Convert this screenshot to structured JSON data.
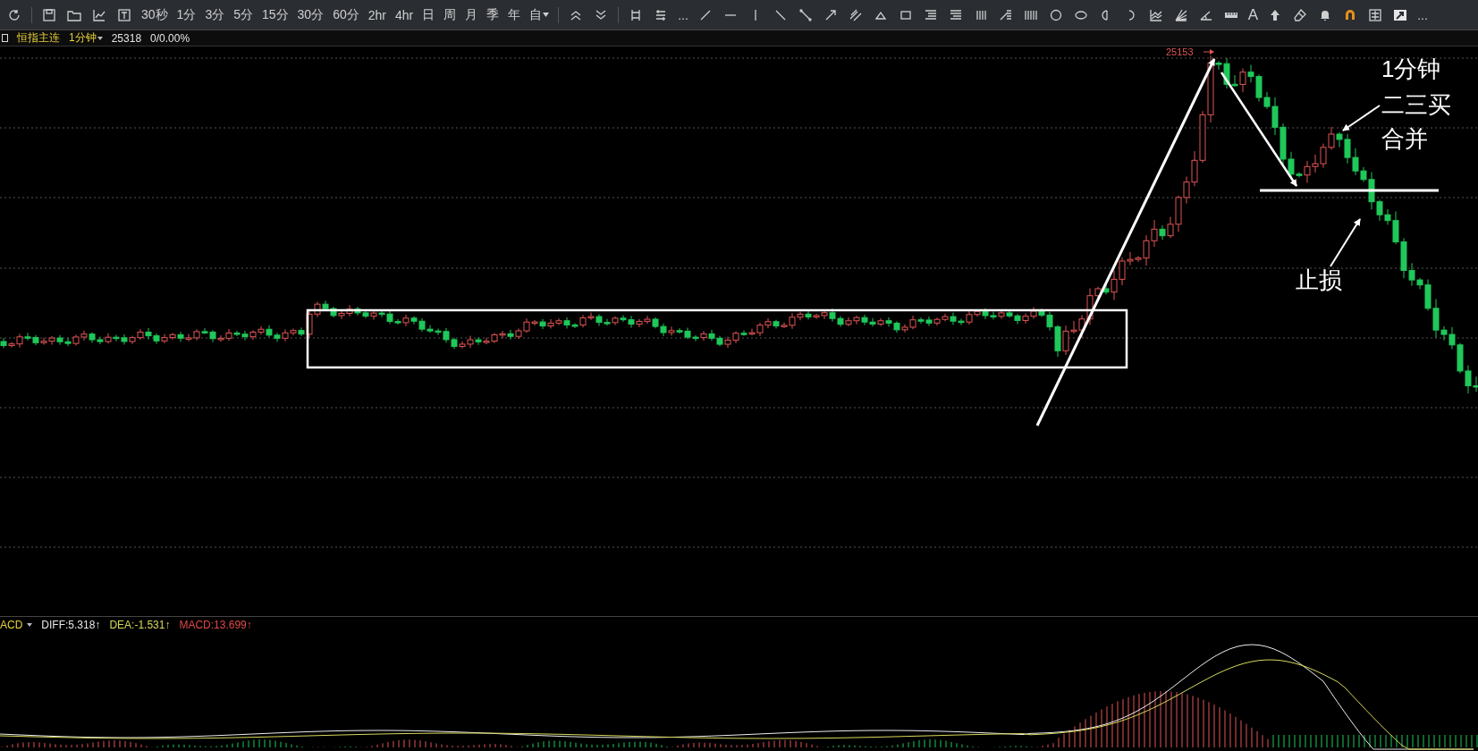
{
  "toolbar": {
    "periods": [
      {
        "label": "30秒",
        "kind": "period"
      },
      {
        "label": "1分",
        "kind": "period"
      },
      {
        "label": "3分",
        "kind": "period"
      },
      {
        "label": "5分",
        "kind": "period"
      },
      {
        "label": "15分",
        "kind": "period"
      },
      {
        "label": "30分",
        "kind": "period"
      },
      {
        "label": "60分",
        "kind": "period"
      },
      {
        "label": "2hr",
        "kind": "period"
      },
      {
        "label": "4hr",
        "kind": "period"
      },
      {
        "label": "日",
        "kind": "period"
      },
      {
        "label": "周",
        "kind": "period"
      },
      {
        "label": "月",
        "kind": "period"
      },
      {
        "label": "季",
        "kind": "period"
      },
      {
        "label": "年",
        "kind": "period"
      },
      {
        "label": "自",
        "kind": "dropdown"
      }
    ],
    "more": "...",
    "text_tool": "A",
    "overflow": "..."
  },
  "header": {
    "symbol": "恒指主连",
    "interval": "1分钟",
    "price": "25318",
    "change": "0/0.00%"
  },
  "chart": {
    "peak_label": "25153",
    "annotations": [
      {
        "text": "1分钟"
      },
      {
        "text": "二三买"
      },
      {
        "text": "合并"
      },
      {
        "text": "止损"
      }
    ]
  },
  "macd": {
    "title": "ACD",
    "values": [
      {
        "text": "DIFF:5.318↑",
        "color": "#e8e8e8"
      },
      {
        "text": "DEA:-1.531↑",
        "color": "#d8d85a"
      },
      {
        "text": "MACD:13.699↑",
        "color": "#e04848"
      }
    ]
  }
}
